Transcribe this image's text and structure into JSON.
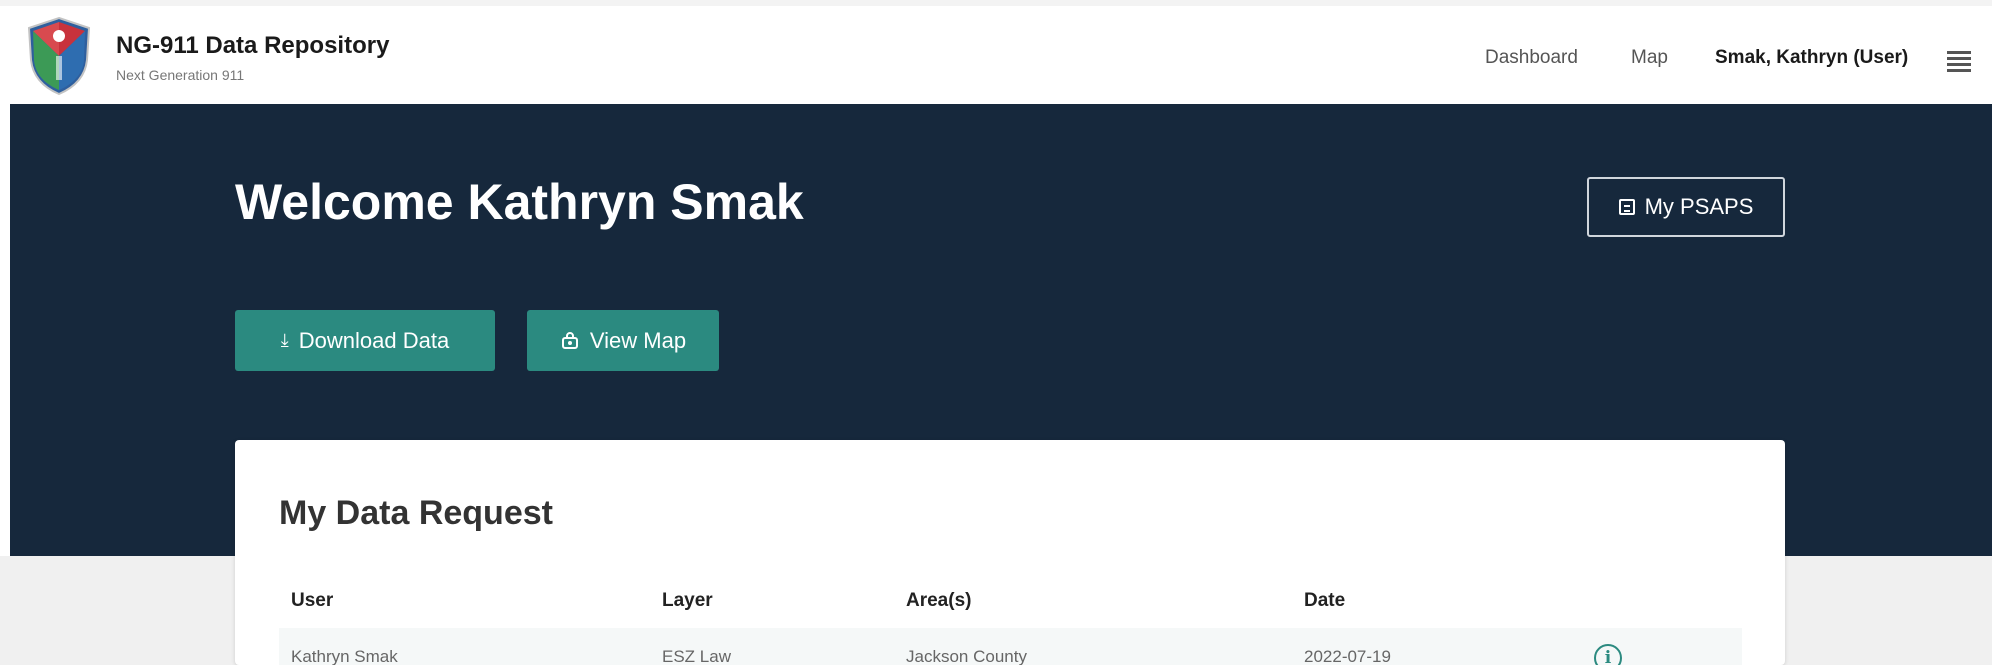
{
  "header": {
    "brand_title": "NG-911 Data Repository",
    "brand_subtitle": "Next Generation 911",
    "nav": {
      "dashboard": "Dashboard",
      "map": "Map",
      "user": "Smak, Kathryn (User)"
    },
    "menu_icon": "hamburger-menu-icon",
    "logo_icon": "shield-logo-icon"
  },
  "hero": {
    "welcome": "Welcome Kathryn Smak",
    "psaps_button": "My PSAPS",
    "download_button": "Download Data",
    "viewmap_button": "View Map"
  },
  "card": {
    "title": "My Data Request",
    "columns": [
      "User",
      "Layer",
      "Area(s)",
      "Date"
    ],
    "rows": [
      {
        "user": "Kathryn Smak",
        "layer": "ESZ Law",
        "areas": "Jackson County",
        "date": "2022-07-19",
        "action_icon": "info-icon"
      }
    ]
  },
  "colors": {
    "hero_bg": "#16283c",
    "accent": "#2b8a80",
    "page_bg": "#f0f0f0"
  }
}
